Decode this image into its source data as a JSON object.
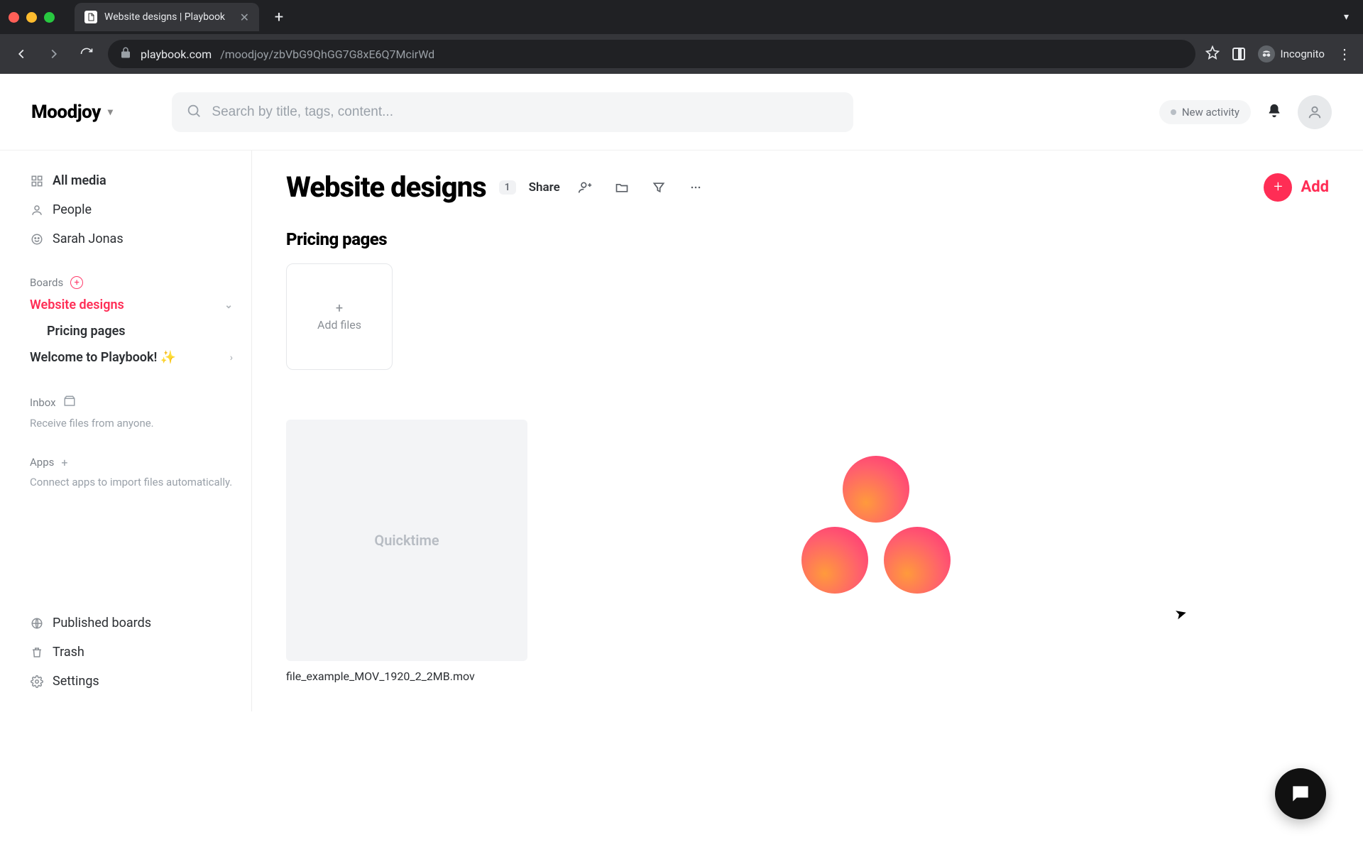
{
  "browser": {
    "tab_title": "Website designs | Playbook",
    "url_domain": "playbook.com",
    "url_path": "/moodjoy/zbVbG9QhGG7G8xE6Q7McirWd",
    "incognito_label": "Incognito"
  },
  "topbar": {
    "workspace_name": "Moodjoy",
    "search_placeholder": "Search by title, tags, content...",
    "new_activity_label": "New activity"
  },
  "sidebar": {
    "all_media": "All media",
    "people": "People",
    "user_name": "Sarah Jonas",
    "boards_label": "Boards",
    "boards": [
      {
        "label": "Website designs",
        "active": true
      },
      {
        "label": "Welcome to Playbook! ✨",
        "active": false
      }
    ],
    "sub_board": "Pricing pages",
    "inbox_label": "Inbox",
    "inbox_desc": "Receive files from anyone.",
    "apps_label": "Apps",
    "apps_desc": "Connect apps to import files automatically.",
    "published_boards": "Published boards",
    "trash": "Trash",
    "settings": "Settings"
  },
  "main": {
    "page_title": "Website designs",
    "count_badge": "1",
    "share_label": "Share",
    "add_label": "Add",
    "section_title": "Pricing pages",
    "add_files_label": "Add files",
    "file_thumb_label": "Quicktime",
    "file_name": "file_example_MOV_1920_2_2MB.mov"
  }
}
